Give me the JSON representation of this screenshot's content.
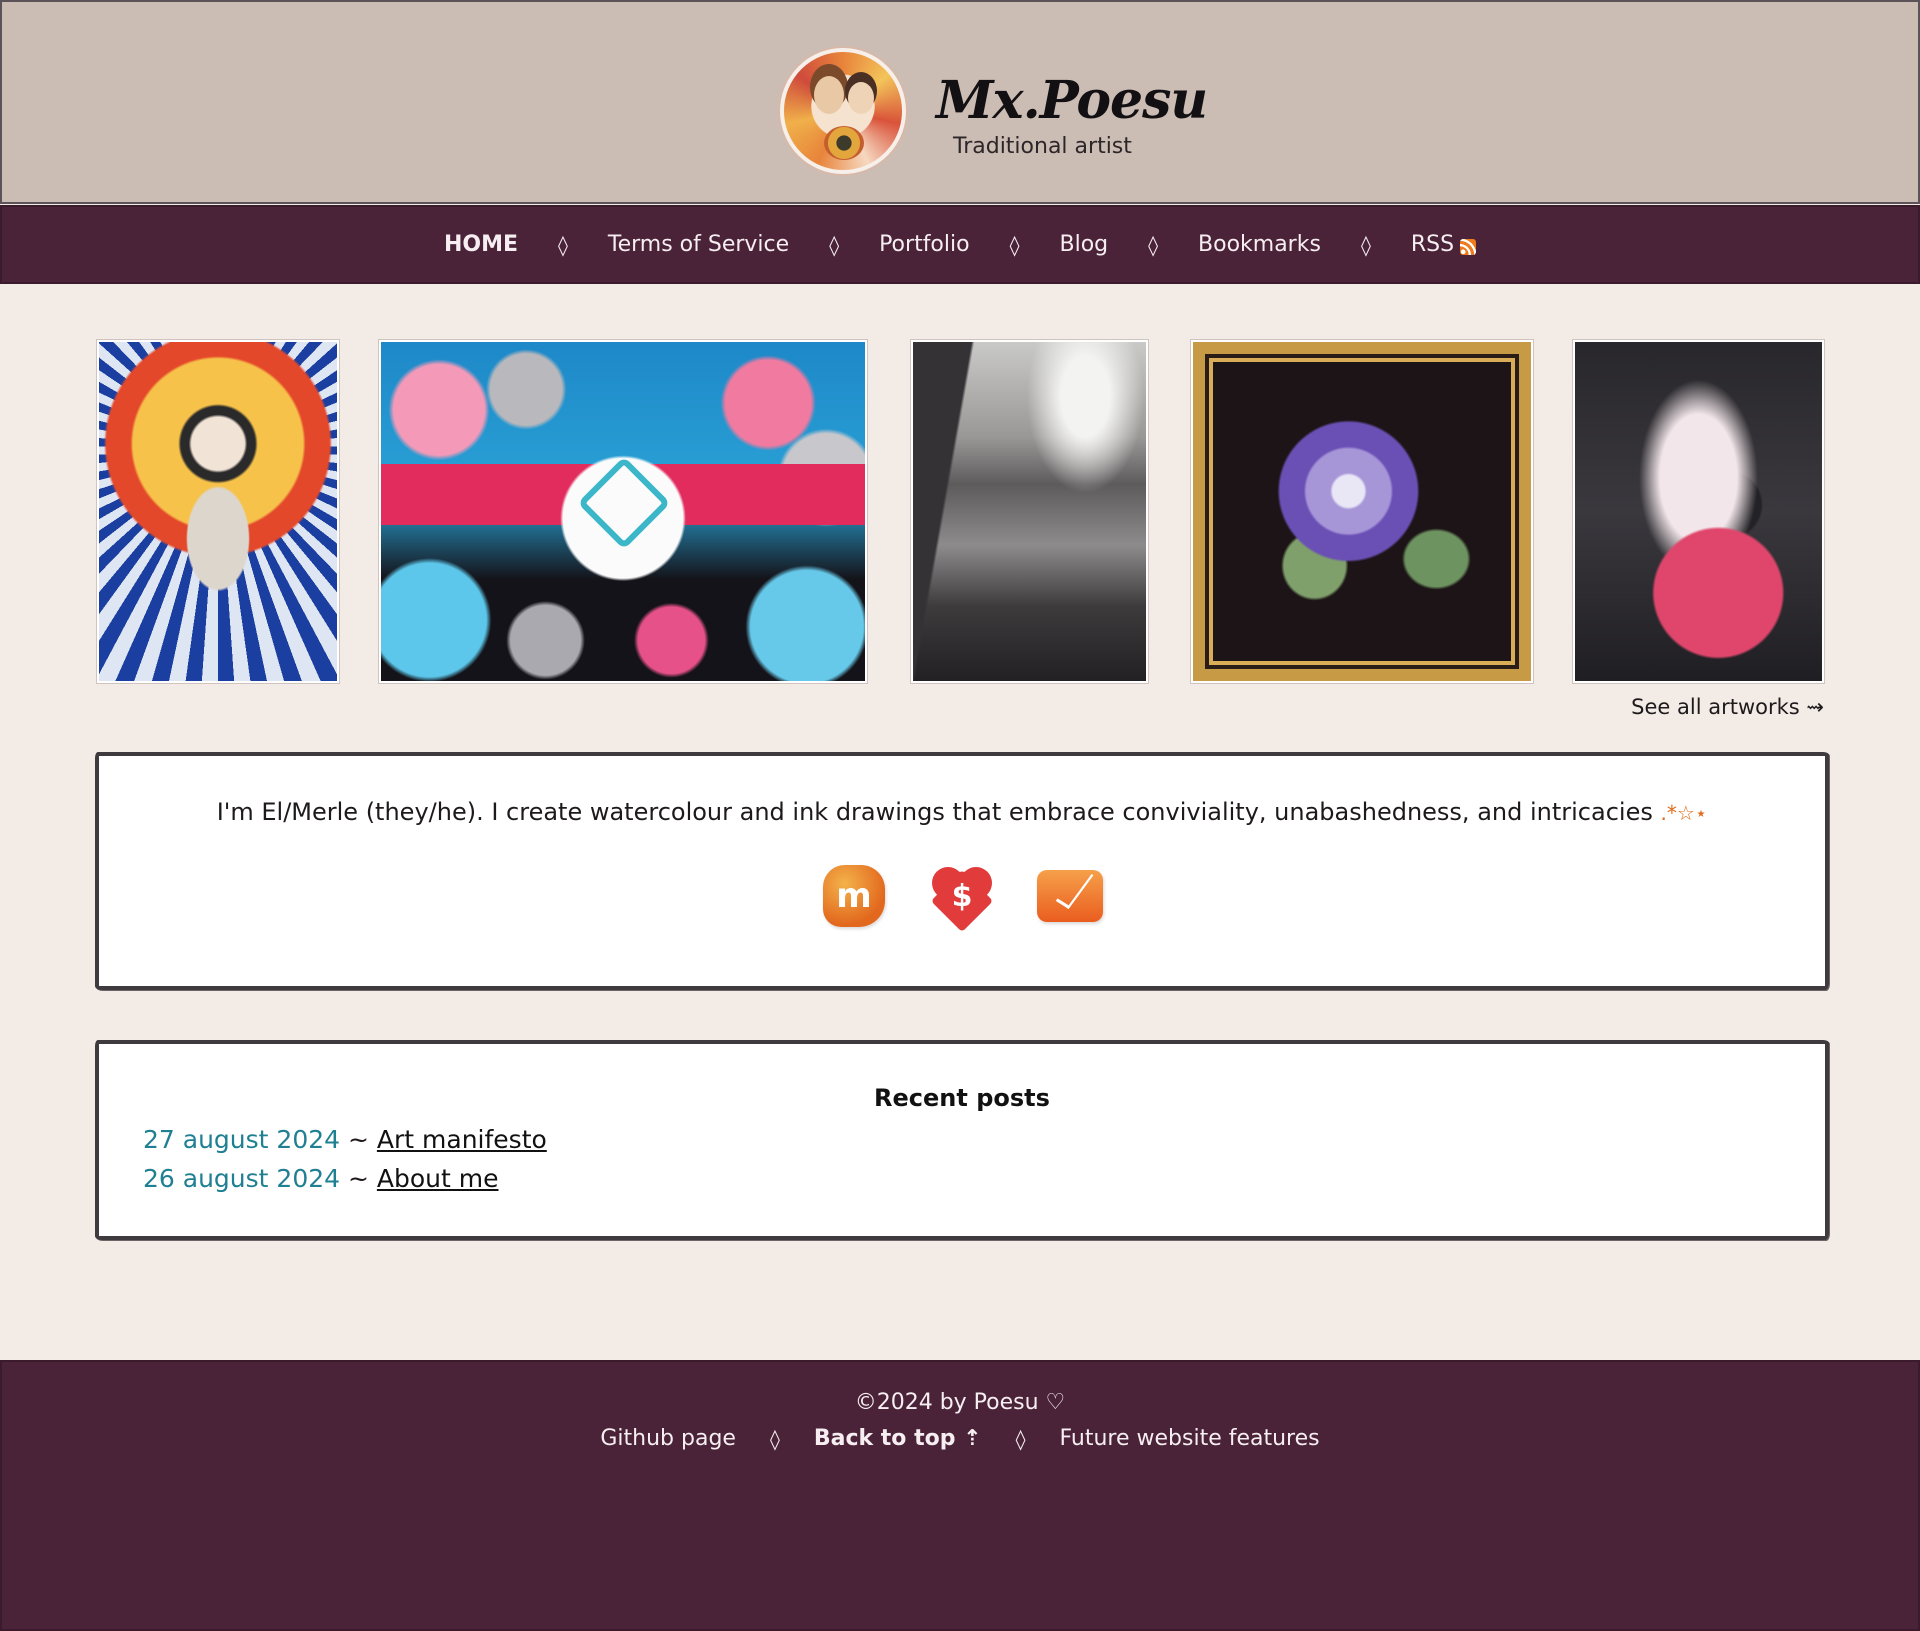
{
  "header": {
    "title": "Mx.Poesu",
    "subtitle": "Traditional artist",
    "avatar_alt": "Poesu avatar"
  },
  "nav": {
    "items": [
      {
        "label": "HOME",
        "active": true
      },
      {
        "label": "Terms of Service",
        "active": false
      },
      {
        "label": "Portfolio",
        "active": false
      },
      {
        "label": "Blog",
        "active": false
      },
      {
        "label": "Bookmarks",
        "active": false
      },
      {
        "label": "RSS",
        "active": false,
        "icon": "rss-icon"
      }
    ],
    "separator": "◊"
  },
  "gallery": {
    "thumbnails": [
      {
        "icon": "artwork-portrait-mandala"
      },
      {
        "icon": "artwork-flowers-heart-knot"
      },
      {
        "icon": "artwork-misty-coast"
      },
      {
        "icon": "artwork-purple-peony-frame"
      },
      {
        "icon": "artwork-pink-creature"
      }
    ],
    "see_all_label": "See all artworks ⇝"
  },
  "intro": {
    "text": "I'm El/Merle (they/he). I create watercolour and ink drawings that embrace conviviality, unabashedness, and intricacies",
    "sparkles": ".*☆⋆",
    "social": [
      {
        "icon": "mastodon-icon",
        "glyph": "m"
      },
      {
        "icon": "donate-heart-icon",
        "glyph": "$"
      },
      {
        "icon": "mail-icon",
        "glyph": ""
      }
    ]
  },
  "posts": {
    "heading": "Recent posts",
    "items": [
      {
        "date": "27 august 2024",
        "separator": " ~ ",
        "title": "Art manifesto"
      },
      {
        "date": "26 august 2024",
        "separator": " ~ ",
        "title": "About me"
      }
    ]
  },
  "footer": {
    "copyright": "©2024 by Poesu ♡",
    "links": [
      {
        "label": "Github page",
        "strong": false
      },
      {
        "label": "Back to top ⇡",
        "strong": true
      },
      {
        "label": "Future website features",
        "strong": false
      }
    ],
    "separator": "◊"
  },
  "colors": {
    "header_bg": "#cbbcb4",
    "nav_bg": "#4a2338",
    "page_bg": "#f3ebe5",
    "card_bg": "#ffffff",
    "date_accent": "#1f7f93",
    "sparkle_accent": "#e06a17"
  }
}
